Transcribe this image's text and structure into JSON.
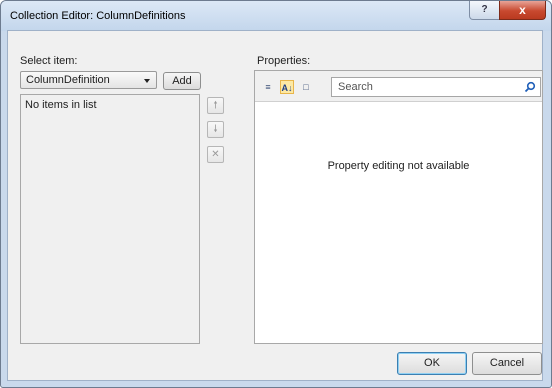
{
  "window": {
    "title": "Collection Editor: ColumnDefinitions",
    "help_label": "?",
    "close_label": "x"
  },
  "left": {
    "select_label": "Select item:",
    "type_combo_value": "ColumnDefinition",
    "add_label": "Add",
    "list_empty_text": "No items in list",
    "move_up_icon": "arrow-up-icon",
    "move_down_icon": "arrow-down-icon",
    "remove_icon": "x-icon"
  },
  "right": {
    "properties_label": "Properties:",
    "toolbar_icons": [
      "categorize-icon",
      "sort-alphabetical-icon",
      "events-icon"
    ],
    "search_placeholder": "Search",
    "no_edit_text": "Property editing not available"
  },
  "footer": {
    "ok_label": "OK",
    "cancel_label": "Cancel"
  },
  "colors": {
    "frame": "#c9d9ec",
    "close_button": "#c8492f",
    "active_toolbar": "#fde9a4",
    "client": "#f0f0f0"
  }
}
